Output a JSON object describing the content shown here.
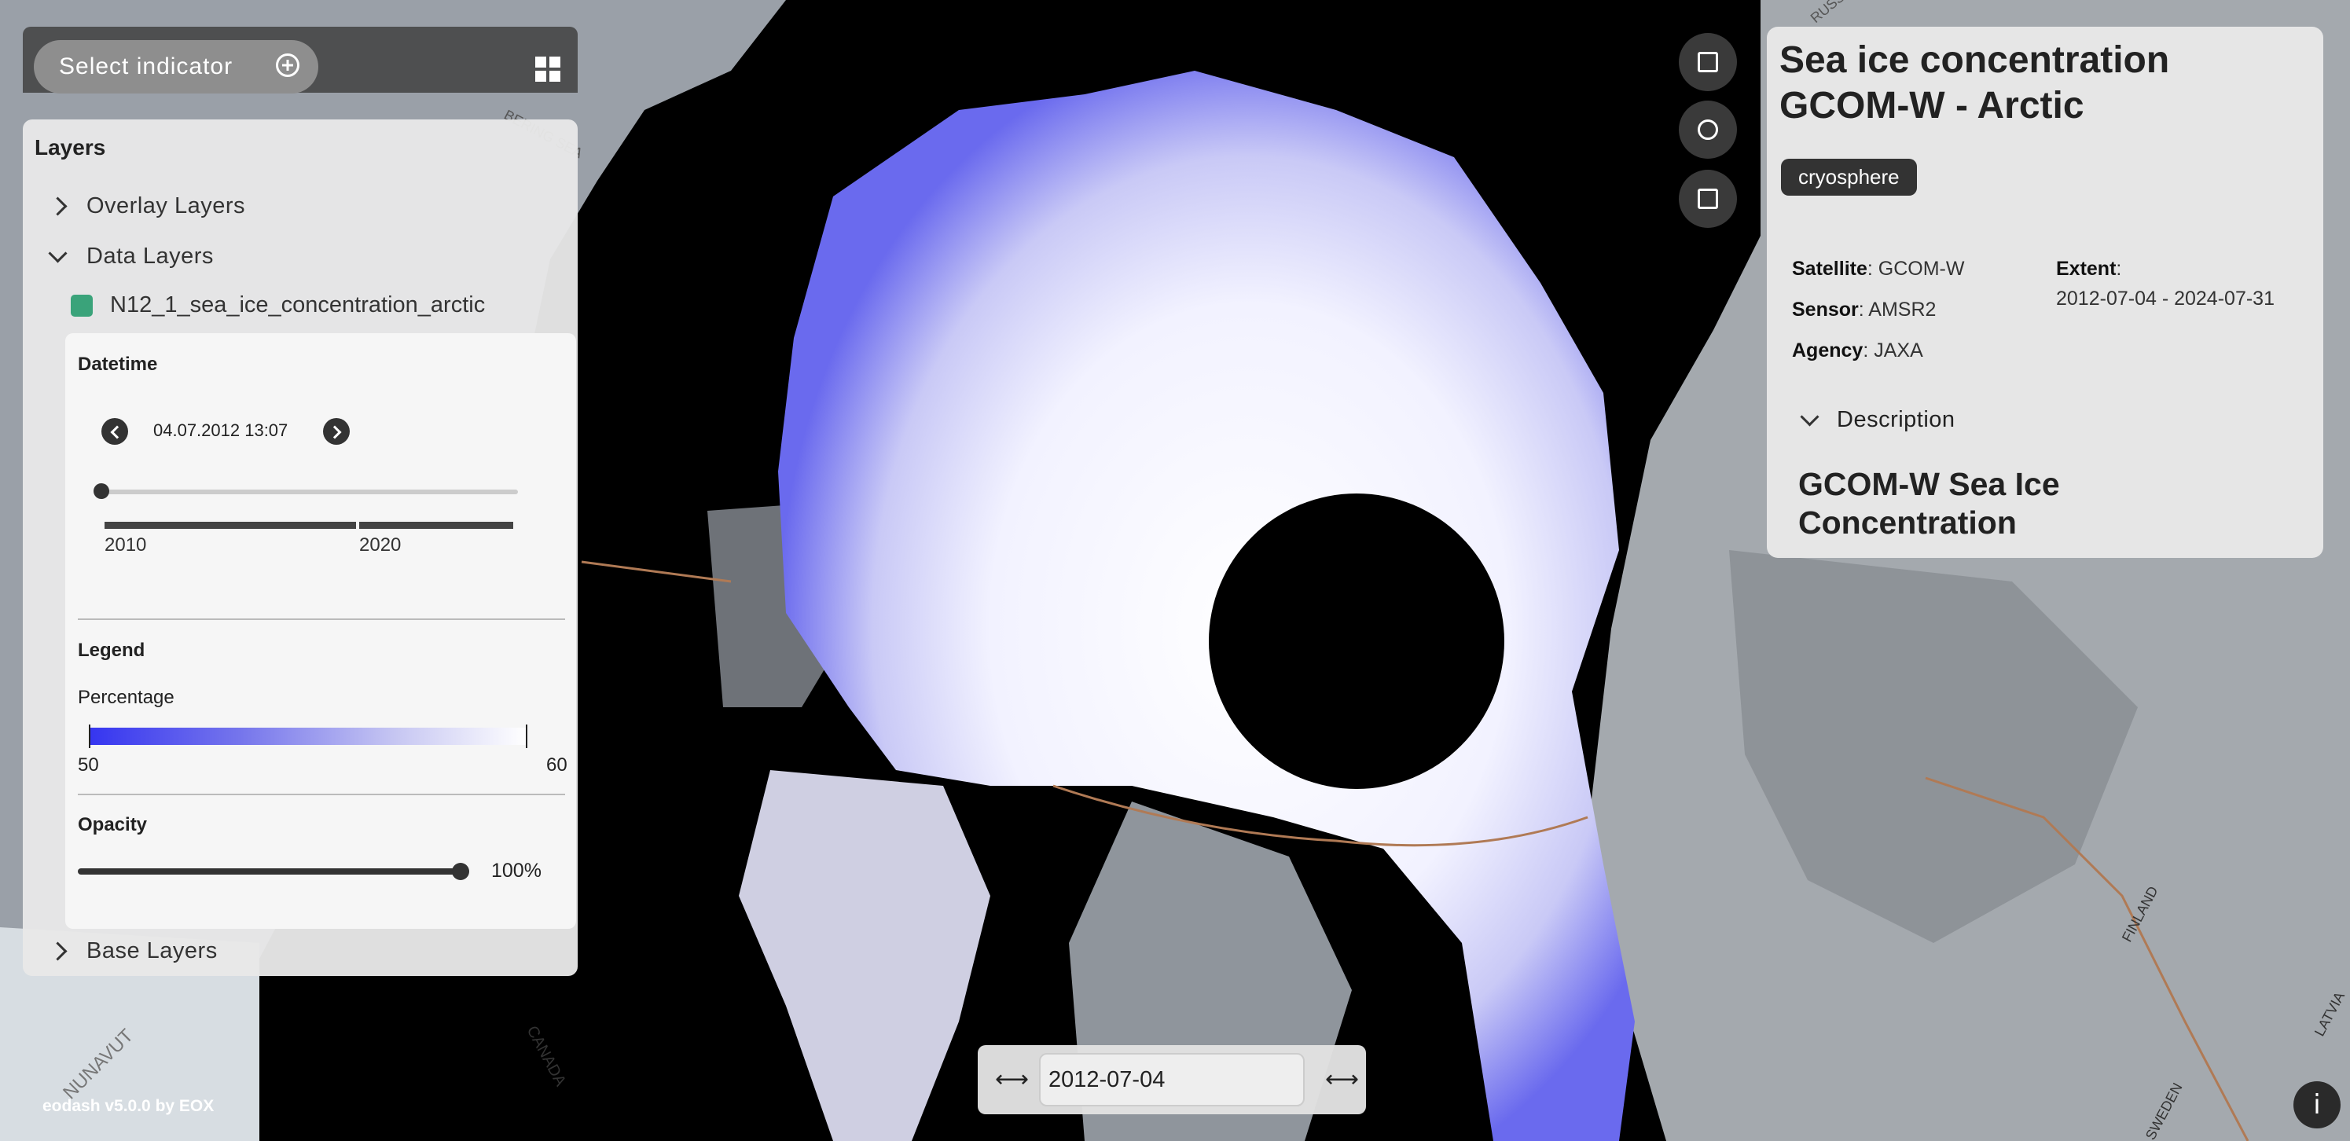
{
  "topbar": {
    "select_indicator_label": "Select indicator"
  },
  "layers_panel": {
    "title": "Layers",
    "groups": [
      {
        "label": "Overlay Layers",
        "expanded": false
      },
      {
        "label": "Data Layers",
        "expanded": true
      },
      {
        "label": "Base Layers",
        "expanded": false
      }
    ],
    "active_layer": {
      "name": "N12_1_sea_ice_concentration_arctic",
      "swatch_color": "#3aa37a",
      "datetime_label": "Datetime",
      "datetime_value": "04.07.2012 13:07",
      "timeline_years": [
        "2010",
        "2020"
      ],
      "legend_label": "Legend",
      "legend_unit": "Percentage",
      "legend_min": "50",
      "legend_max": "60",
      "opacity_label": "Opacity",
      "opacity_value": "100%"
    }
  },
  "map": {
    "map_labels": [
      "BERING SEA",
      "CANADA",
      "NUNAVUT",
      "FINLAND",
      "LATVIA",
      "SWEDEN",
      "RUSSIA"
    ]
  },
  "info_panel": {
    "title": "Sea ice concentration GCOM-W - Arctic",
    "tag": "cryosphere",
    "satellite_key": "Satellite",
    "satellite_value": "GCOM-W",
    "sensor_key": "Sensor",
    "sensor_value": "AMSR2",
    "agency_key": "Agency",
    "agency_value": "JAXA",
    "extent_key": "Extent",
    "extent_value": "2012-07-04 - 2024-07-31",
    "description_toggle": "Description",
    "description_title": "GCOM-W Sea Ice Concentration"
  },
  "datebar": {
    "left_arrow": "⟷",
    "right_arrow": "⟷",
    "date_value": "2012-07-04"
  },
  "footer": {
    "text": "eodash v5.0.0 by EOX",
    "info_button": "i"
  }
}
